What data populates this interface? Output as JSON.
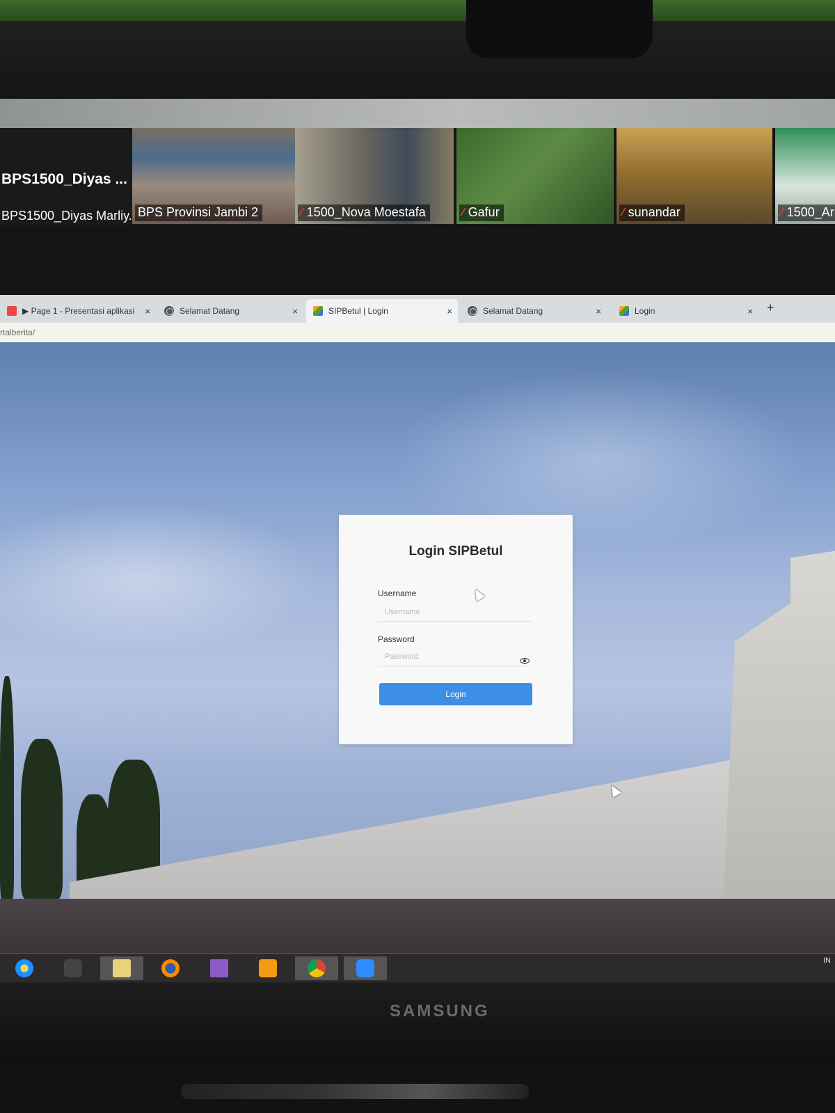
{
  "zoom": {
    "active_speaker": {
      "title": "BPS1500_Diyas ...",
      "subtitle": "BPS1500_Diyas Marliy..."
    },
    "participants": [
      {
        "name": "BPS Provinsi Jambi 2",
        "muted": false
      },
      {
        "name": "1500_Nova Moestafa",
        "muted": true
      },
      {
        "name": "Gafur",
        "muted": true
      },
      {
        "name": "sunandar",
        "muted": true
      },
      {
        "name": "1500_Ar",
        "muted": true
      }
    ]
  },
  "browser": {
    "tabs": [
      {
        "title": "▶ Page 1 - Presentasi aplikasi",
        "icon": "app-icon"
      },
      {
        "title": "Selamat Datang",
        "icon": "globe-icon"
      },
      {
        "title": "SIPBetul | Login",
        "icon": "bps-favicon"
      },
      {
        "title": "Selamat Datang",
        "icon": "globe-icon"
      },
      {
        "title": "Login",
        "icon": "bps-favicon"
      }
    ],
    "close_symbol": "×",
    "new_tab_symbol": "+",
    "url": "rtalberita/"
  },
  "login": {
    "title": "Login SIPBetul",
    "username_label": "Username",
    "username_placeholder": "Username",
    "password_label": "Password",
    "password_placeholder": "Password",
    "button_label": "Login",
    "button_color": "#3d8ee6"
  },
  "taskbar": {
    "items": [
      "ie-icon",
      "user-icon",
      "folder-icon",
      "firefox-icon",
      "visual-studio-icon",
      "media-player-icon",
      "chrome-icon",
      "zoom-icon"
    ],
    "language": "IN"
  },
  "monitor": {
    "brand": "SAMSUNG"
  }
}
